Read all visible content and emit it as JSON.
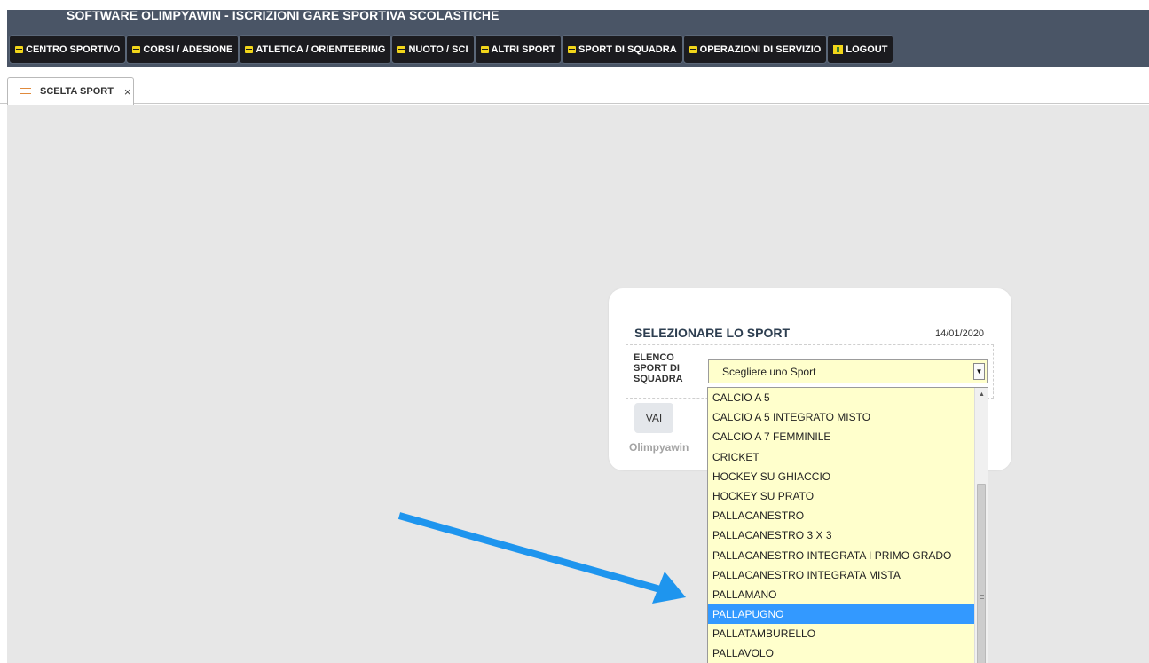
{
  "app": {
    "title": "SOFTWARE OLIMPYAWIN - ISCRIZIONI GARE SPORTIVA SCOLASTICHE"
  },
  "menu": [
    {
      "label": "CENTRO SPORTIVO",
      "icon": "menu-icon"
    },
    {
      "label": "CORSI / ADESIONE",
      "icon": "menu-icon"
    },
    {
      "label": "ATLETICA / ORIENTEERING",
      "icon": "menu-icon"
    },
    {
      "label": "NUOTO / SCI",
      "icon": "menu-icon"
    },
    {
      "label": "ALTRI SPORT",
      "icon": "menu-icon"
    },
    {
      "label": "SPORT DI SQUADRA",
      "icon": "menu-icon"
    },
    {
      "label": "OPERAZIONI DI SERVIZIO",
      "icon": "menu-icon"
    },
    {
      "label": "LOGOUT",
      "icon": "logout-icon"
    }
  ],
  "tab": {
    "label": "SCELTA SPORT",
    "close": "×"
  },
  "form": {
    "title": "SELEZIONARE LO SPORT",
    "date": "14/01/2020",
    "field_label": "ELENCO SPORT DI SQUADRA",
    "select_value": "Scegliere uno Sport",
    "button": "VAI",
    "brand": "Olimpyawin"
  },
  "dropdown": {
    "options": [
      "CALCIO A 5",
      "CALCIO A 5 INTEGRATO MISTO",
      "CALCIO A 7 FEMMINILE",
      "CRICKET",
      "HOCKEY SU GHIACCIO",
      "HOCKEY SU PRATO",
      "PALLACANESTRO",
      "PALLACANESTRO 3 X 3",
      "PALLACANESTRO INTEGRATA I PRIMO GRADO",
      "PALLACANESTRO INTEGRATA MISTA",
      "PALLAMANO",
      "PALLAPUGNO",
      "PALLATAMBURELLO",
      "PALLAVOLO"
    ],
    "selected": "PALLAPUGNO"
  },
  "colors": {
    "header": "#4a5566",
    "menu_bg": "#1b1b1f",
    "icon_yellow": "#f1d51a",
    "select_bg": "#ffffcc",
    "highlight": "#3399ff",
    "annotation_arrow": "#1e95ee"
  }
}
